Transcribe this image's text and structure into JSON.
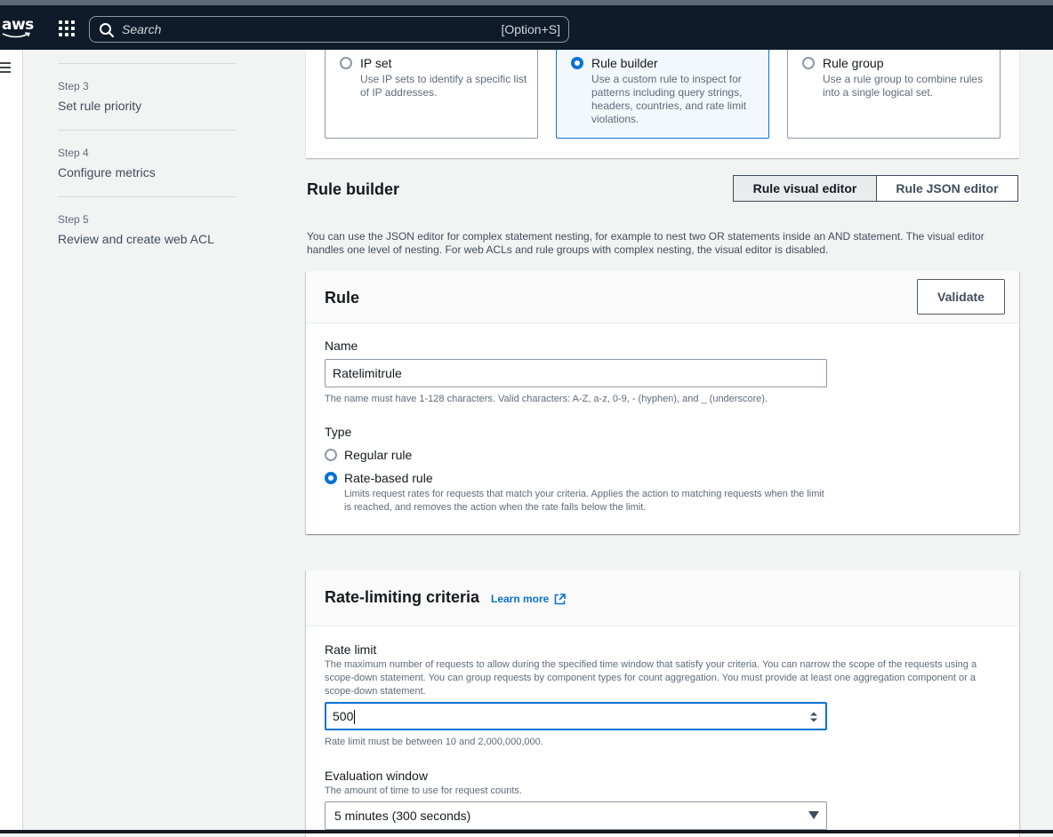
{
  "header": {
    "logo_text": "aws",
    "search_placeholder": "Search",
    "search_shortcut": "[Option+S]"
  },
  "icons": {
    "menu": "hamburger-icon",
    "apps": "grid-icon",
    "search": "search-icon",
    "external": "external-link-icon",
    "stepper": "stepper-icon",
    "dropdown": "caret-down-icon"
  },
  "colors": {
    "accent": "#0972d3",
    "topbar": "#0f1b2a",
    "background": "#f2f3f3"
  },
  "steps": [
    {
      "label": "Step 3",
      "title": "Set rule priority"
    },
    {
      "label": "Step 4",
      "title": "Configure metrics"
    },
    {
      "label": "Step 5",
      "title": "Review and create web ACL"
    }
  ],
  "rule_type_choices": [
    {
      "title": "IP set",
      "description": "Use IP sets to identify a specific list of IP addresses.",
      "selected": false
    },
    {
      "title": "Rule builder",
      "description": "Use a custom rule to inspect for patterns including query strings, headers, countries, and rate limit violations.",
      "selected": true
    },
    {
      "title": "Rule group",
      "description": "Use a rule group to combine rules into a single logical set.",
      "selected": false
    }
  ],
  "rule_builder": {
    "heading": "Rule builder",
    "visual_editor_label": "Rule visual editor",
    "json_editor_label": "Rule JSON editor",
    "note": "You can use the JSON editor for complex statement nesting, for example to nest two OR statements inside an AND statement. The visual editor handles one level of nesting. For web ACLs and rule groups with complex nesting, the visual editor is disabled."
  },
  "rule": {
    "title": "Rule",
    "validate_label": "Validate",
    "name_label": "Name",
    "name_value": "Ratelimitrule",
    "name_help": "The name must have 1-128 characters. Valid characters: A-Z, a-z, 0-9, - (hyphen), and _ (underscore).",
    "type_label": "Type",
    "type_options": [
      {
        "label": "Regular rule",
        "selected": false
      },
      {
        "label": "Rate-based rule",
        "selected": true,
        "description": "Limits request rates for requests that match your criteria. Applies the action to matching requests when the limit is reached, and removes the action when the rate falls below the limit."
      }
    ]
  },
  "rate_criteria": {
    "title": "Rate-limiting criteria",
    "learn_more": "Learn more",
    "rate_limit_label": "Rate limit",
    "rate_limit_desc": "The maximum number of requests to allow during the specified time window that satisfy your criteria. You can narrow the scope of the requests using a scope-down statement. You can group requests by component types for count aggregation. You must provide at least one aggregation component or a scope-down statement.",
    "rate_limit_value": "500",
    "rate_limit_help": "Rate limit must be between 10 and 2,000,000,000.",
    "window_label": "Evaluation window",
    "window_desc": "The amount of time to use for request counts.",
    "window_value": "5 minutes (300 seconds)"
  }
}
